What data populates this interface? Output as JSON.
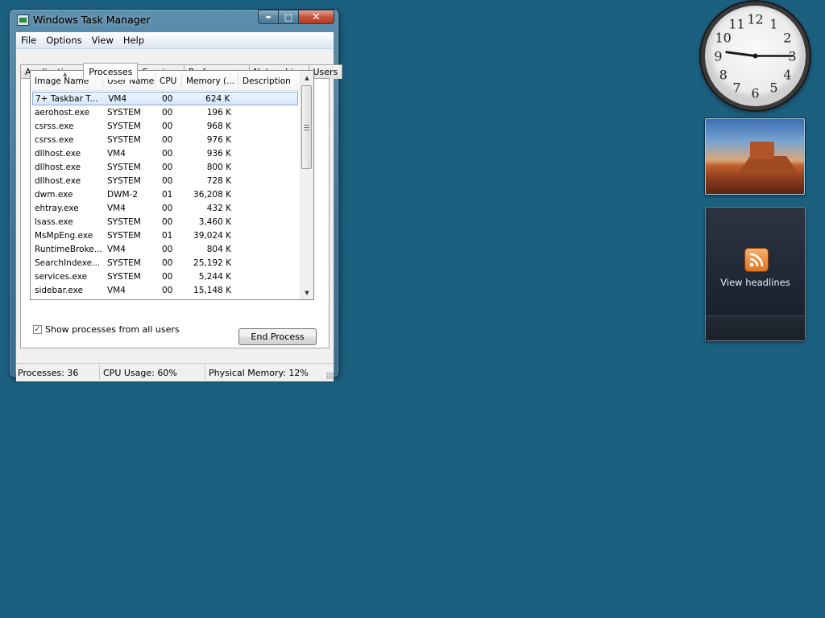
{
  "window": {
    "title": "Windows Task Manager",
    "minimize_glyph": "▬",
    "maximize_glyph": "□",
    "close_glyph": "✕"
  },
  "menu": [
    "File",
    "Options",
    "View",
    "Help"
  ],
  "tabs": [
    {
      "label": "Applications",
      "active": false
    },
    {
      "label": "Processes",
      "active": true
    },
    {
      "label": "Services",
      "active": false
    },
    {
      "label": "Performance",
      "active": false
    },
    {
      "label": "Networking",
      "active": false
    },
    {
      "label": "Users",
      "active": false
    }
  ],
  "columns": [
    "Image Name",
    "User Name",
    "CPU",
    "Memory (...",
    "Description"
  ],
  "processes": [
    {
      "name": "7+ Taskbar T...",
      "user": "VM4",
      "cpu": "00",
      "memory": "624 K",
      "selected": true
    },
    {
      "name": "aerohost.exe",
      "user": "SYSTEM",
      "cpu": "00",
      "memory": "196 K"
    },
    {
      "name": "csrss.exe",
      "user": "SYSTEM",
      "cpu": "00",
      "memory": "968 K"
    },
    {
      "name": "csrss.exe",
      "user": "SYSTEM",
      "cpu": "00",
      "memory": "976 K"
    },
    {
      "name": "dllhost.exe",
      "user": "VM4",
      "cpu": "00",
      "memory": "936 K"
    },
    {
      "name": "dllhost.exe",
      "user": "SYSTEM",
      "cpu": "00",
      "memory": "800 K"
    },
    {
      "name": "dllhost.exe",
      "user": "SYSTEM",
      "cpu": "00",
      "memory": "728 K"
    },
    {
      "name": "dwm.exe",
      "user": "DWM-2",
      "cpu": "01",
      "memory": "36,208 K"
    },
    {
      "name": "ehtray.exe",
      "user": "VM4",
      "cpu": "00",
      "memory": "432 K"
    },
    {
      "name": "lsass.exe",
      "user": "SYSTEM",
      "cpu": "00",
      "memory": "3,460 K"
    },
    {
      "name": "MsMpEng.exe",
      "user": "SYSTEM",
      "cpu": "01",
      "memory": "39,024 K"
    },
    {
      "name": "RuntimeBroke...",
      "user": "VM4",
      "cpu": "00",
      "memory": "804 K"
    },
    {
      "name": "SearchIndexe...",
      "user": "SYSTEM",
      "cpu": "00",
      "memory": "25,192 K"
    },
    {
      "name": "services.exe",
      "user": "SYSTEM",
      "cpu": "00",
      "memory": "5,244 K"
    },
    {
      "name": "sidebar.exe",
      "user": "VM4",
      "cpu": "00",
      "memory": "15,148 K"
    }
  ],
  "show_all_label": "Show processes from all users",
  "show_all_checked": true,
  "end_process_label": "End Process",
  "status": {
    "processes": "Processes: 36",
    "cpu": "CPU Usage: 60%",
    "memory": "Physical Memory: 12%"
  },
  "gadgets": {
    "clock": {
      "hour": 9,
      "minute": 15,
      "numerals": [
        "12",
        "1",
        "2",
        "3",
        "4",
        "5",
        "6",
        "7",
        "8",
        "9",
        "10",
        "11"
      ]
    },
    "feed_label": "View headlines"
  }
}
